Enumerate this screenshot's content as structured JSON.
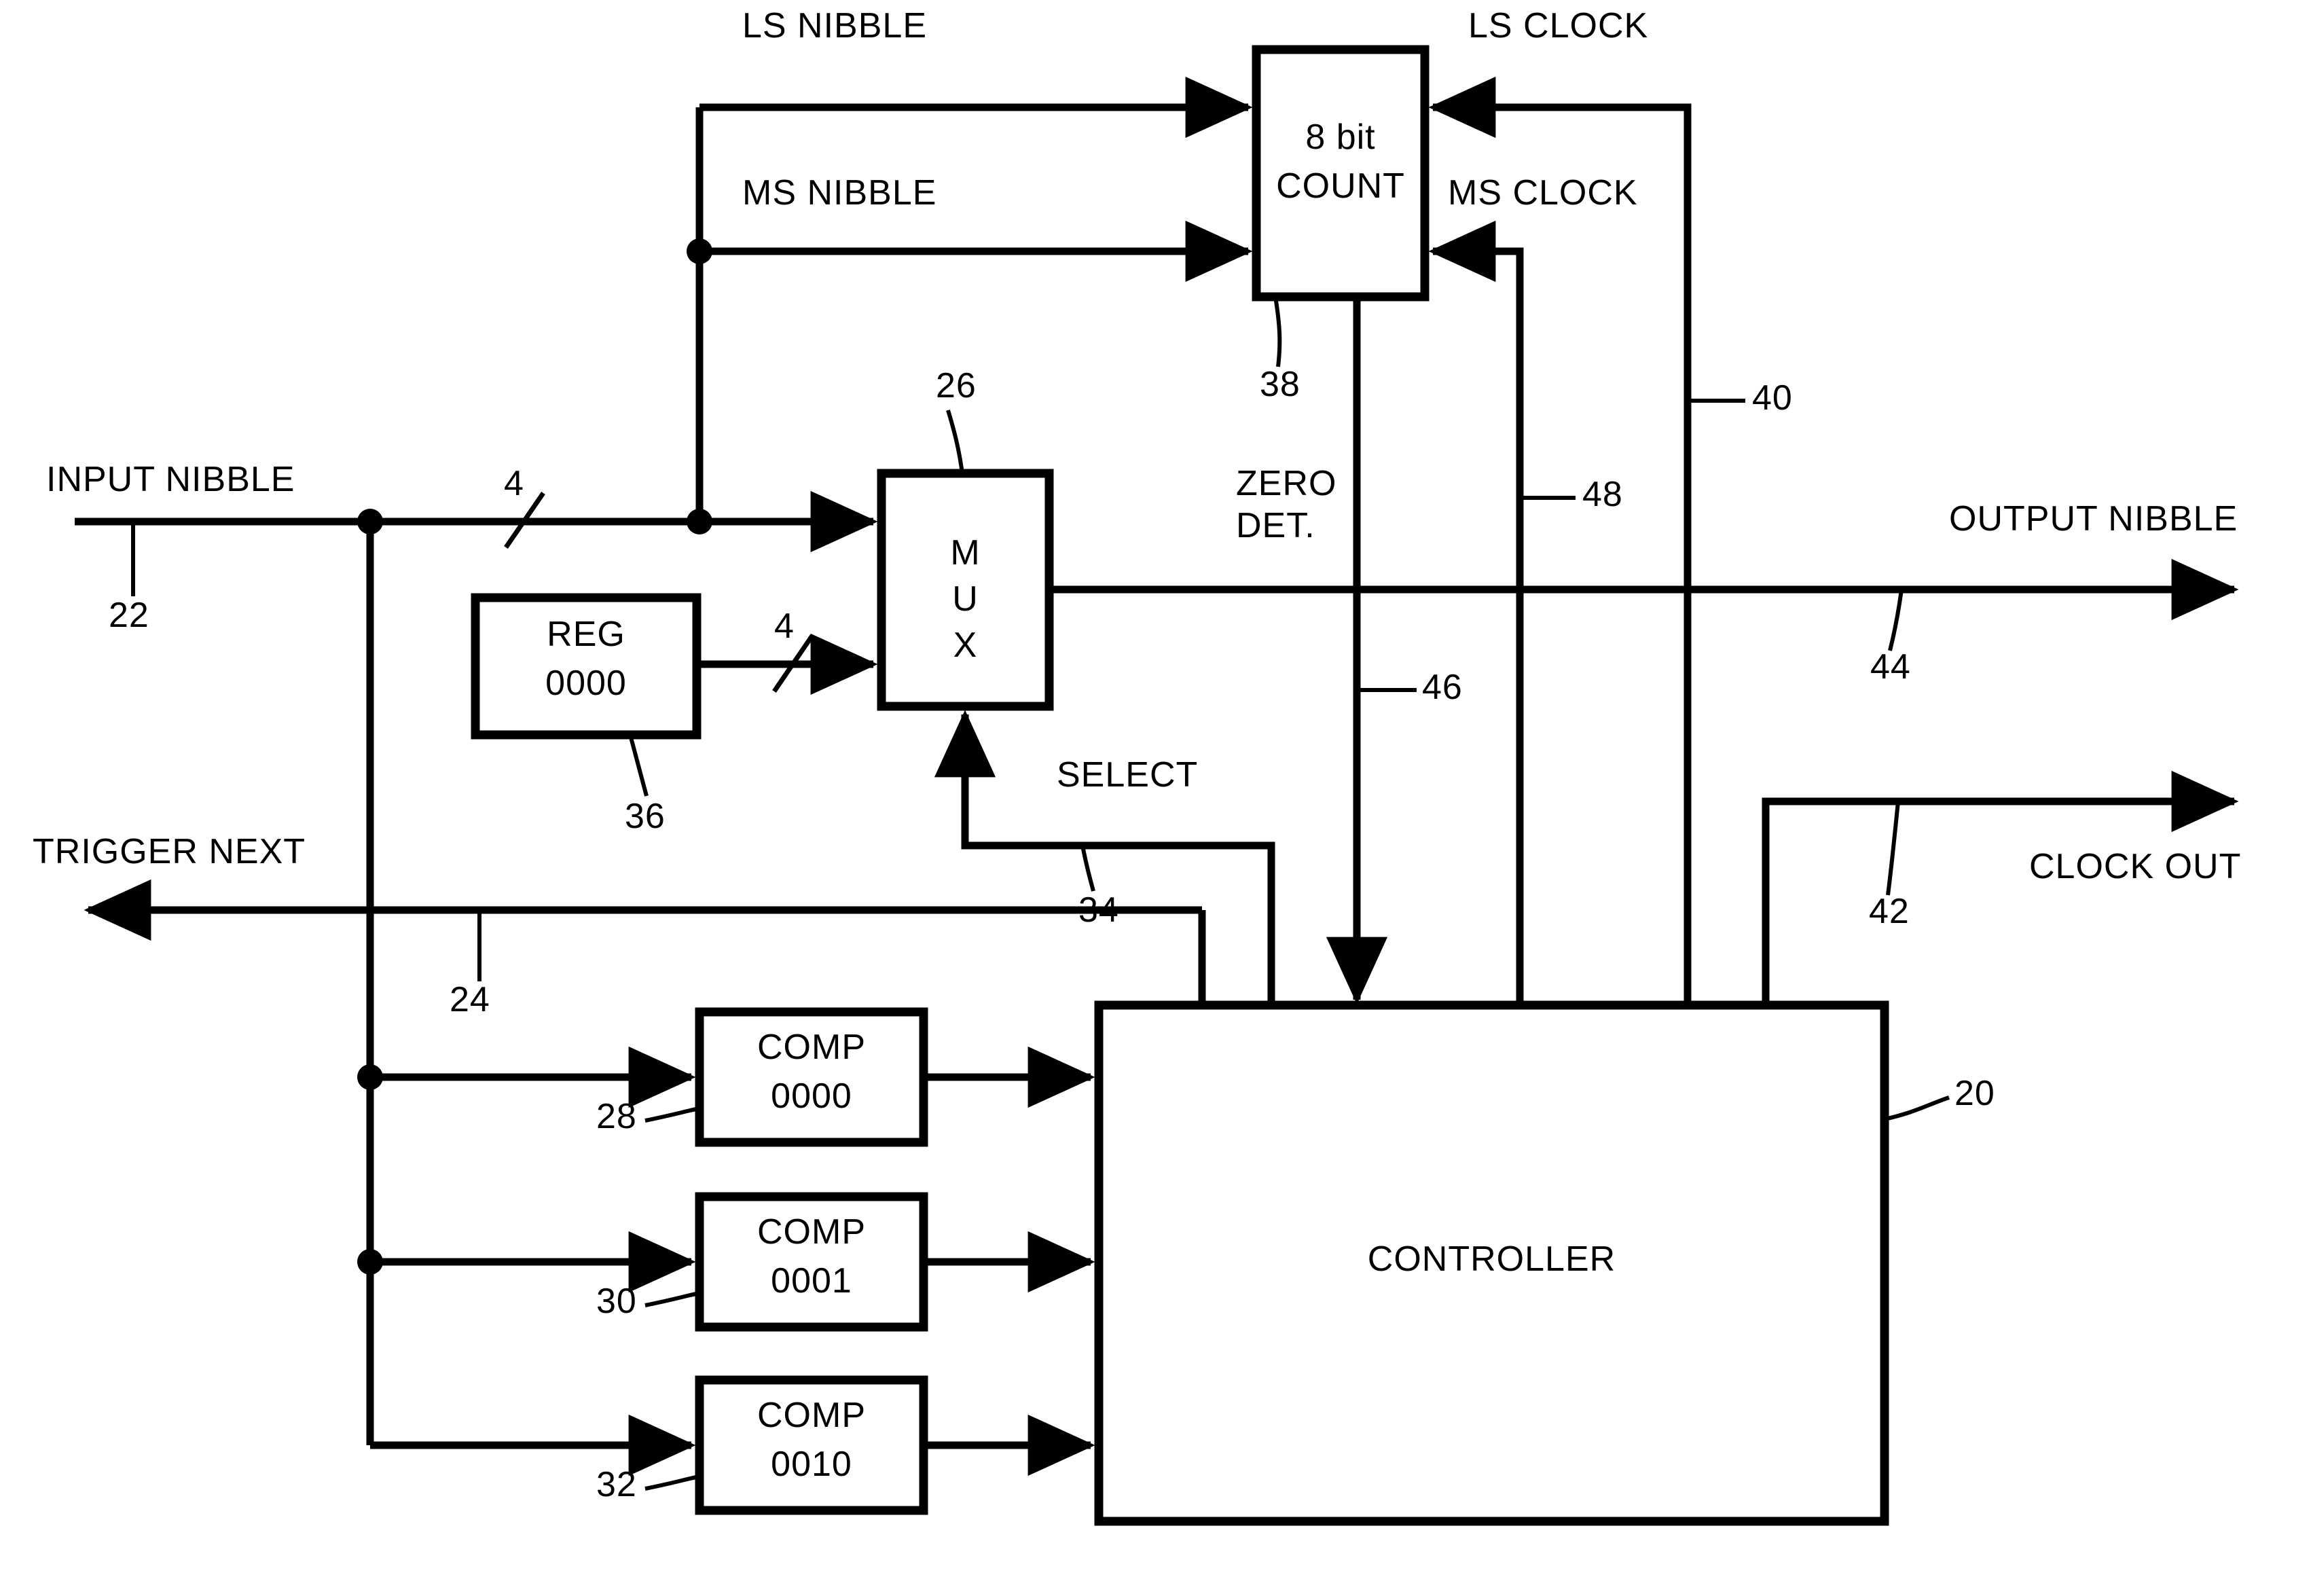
{
  "figure": {
    "type": "patent-block-diagram",
    "title": "Nibble counter / controller block diagram"
  },
  "blocks": {
    "count": {
      "line1": "8 bit",
      "line2": "COUNT",
      "ref": "38"
    },
    "mux": {
      "letters": [
        "M",
        "U",
        "X"
      ],
      "ref": "26"
    },
    "reg": {
      "line1": "REG",
      "line2": "0000",
      "ref": "36"
    },
    "comp1": {
      "line1": "COMP",
      "line2": "0000",
      "ref": "28"
    },
    "comp2": {
      "line1": "COMP",
      "line2": "0001",
      "ref": "30"
    },
    "comp3": {
      "line1": "COMP",
      "line2": "0010",
      "ref": "32"
    },
    "controller": {
      "label": "CONTROLLER",
      "ref": "20"
    }
  },
  "signals": {
    "ls_nibble": "LS NIBBLE",
    "ms_nibble": "MS NIBBLE",
    "ls_clock": "LS CLOCK",
    "ms_clock": "MS CLOCK",
    "input_nibble": "INPUT NIBBLE",
    "output_nibble": "OUTPUT NIBBLE",
    "trigger_next": "TRIGGER NEXT",
    "clock_out": "CLOCK OUT",
    "select": "SELECT",
    "zero_det_line1": "ZERO",
    "zero_det_line2": "DET."
  },
  "bus_widths": {
    "input_bus": "4",
    "reg_bus": "4"
  },
  "reference_numerals": {
    "input_nibble": "22",
    "trigger_next": "24",
    "mux": "26",
    "comp1": "28",
    "comp2": "30",
    "comp3": "32",
    "select": "34",
    "reg": "36",
    "count": "38",
    "ls_clock_line": "40",
    "clock_out": "42",
    "output_nibble": "44",
    "zero_det_line": "46",
    "ms_clock_line": "48",
    "controller": "20"
  },
  "colors": {
    "ink": "#000000",
    "paper": "#ffffff"
  }
}
